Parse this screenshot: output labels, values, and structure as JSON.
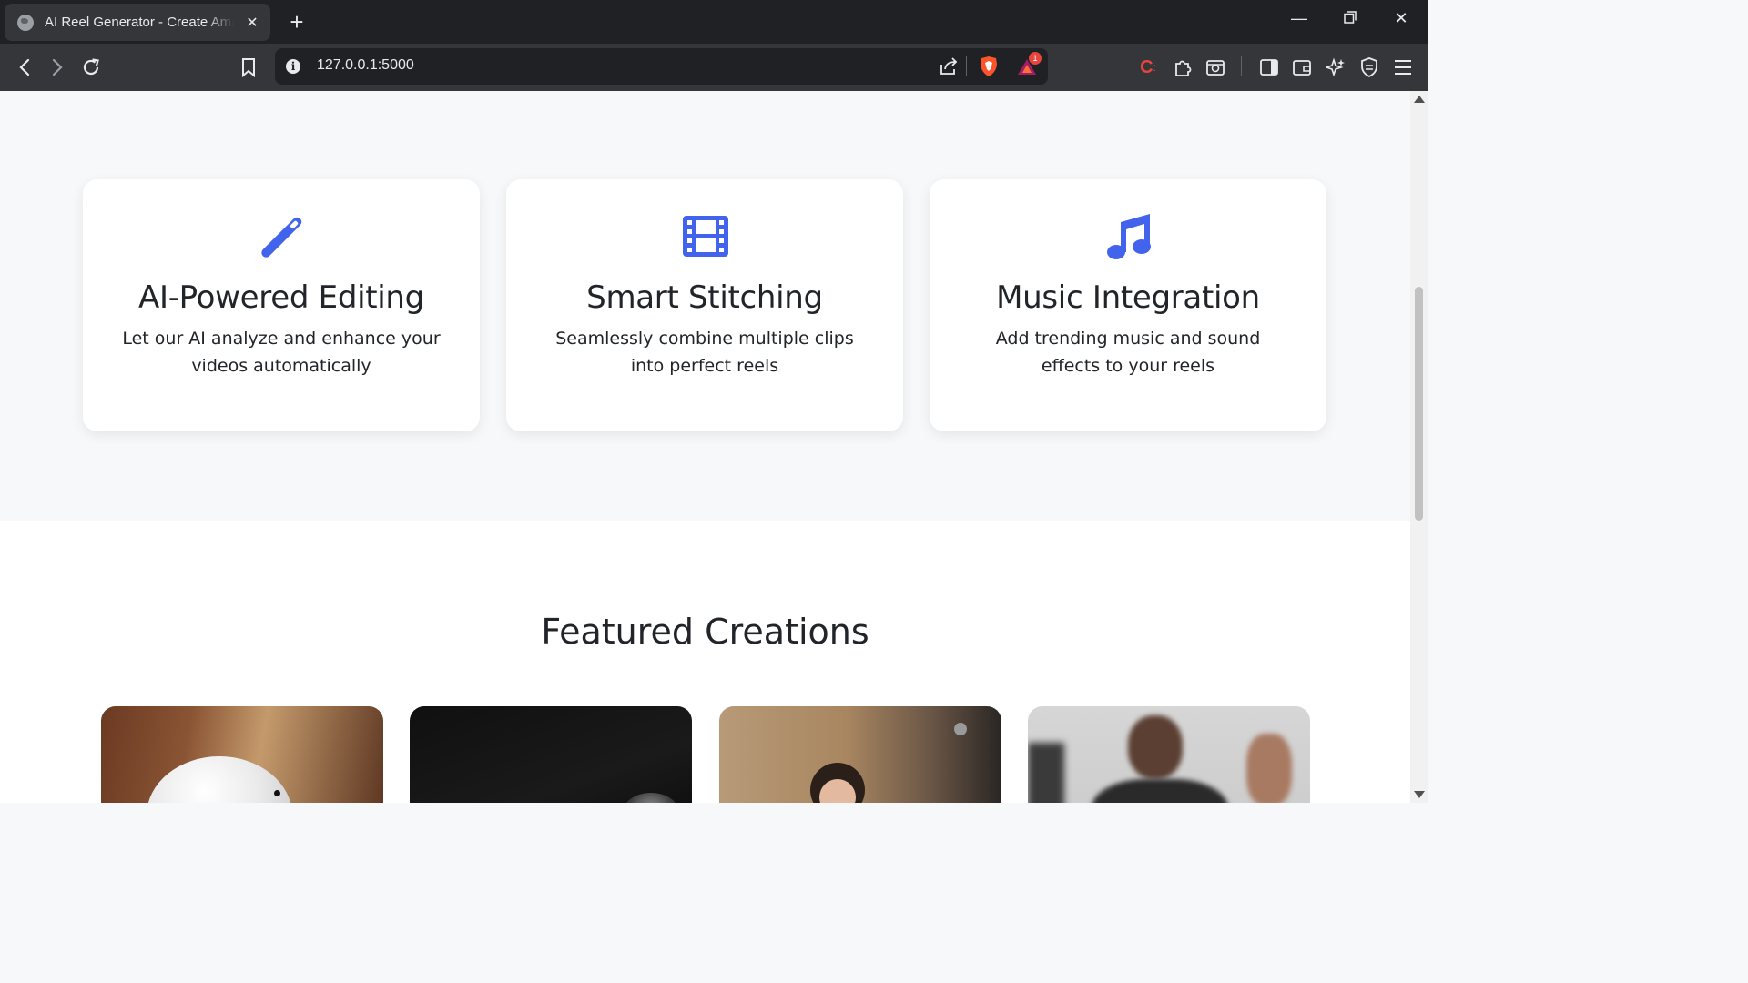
{
  "browser": {
    "tab_title": "AI Reel Generator - Create Amazing Reels",
    "url": "127.0.0.1:5000",
    "notification_badge": "1"
  },
  "features": [
    {
      "icon": "magic-wand-icon",
      "title": "AI-Powered Editing",
      "description": "Let our AI analyze and enhance your videos automatically"
    },
    {
      "icon": "film-icon",
      "title": "Smart Stitching",
      "description": "Seamlessly combine multiple clips into perfect reels"
    },
    {
      "icon": "music-note-icon",
      "title": "Music Integration",
      "description": "Add trending music and sound effects to your reels"
    }
  ],
  "featured": {
    "heading": "Featured Creations"
  },
  "colors": {
    "accent": "#4263eb",
    "chrome_dark": "#202124",
    "chrome_toolbar": "#35363a",
    "page_bg": "#f7f8fa"
  }
}
